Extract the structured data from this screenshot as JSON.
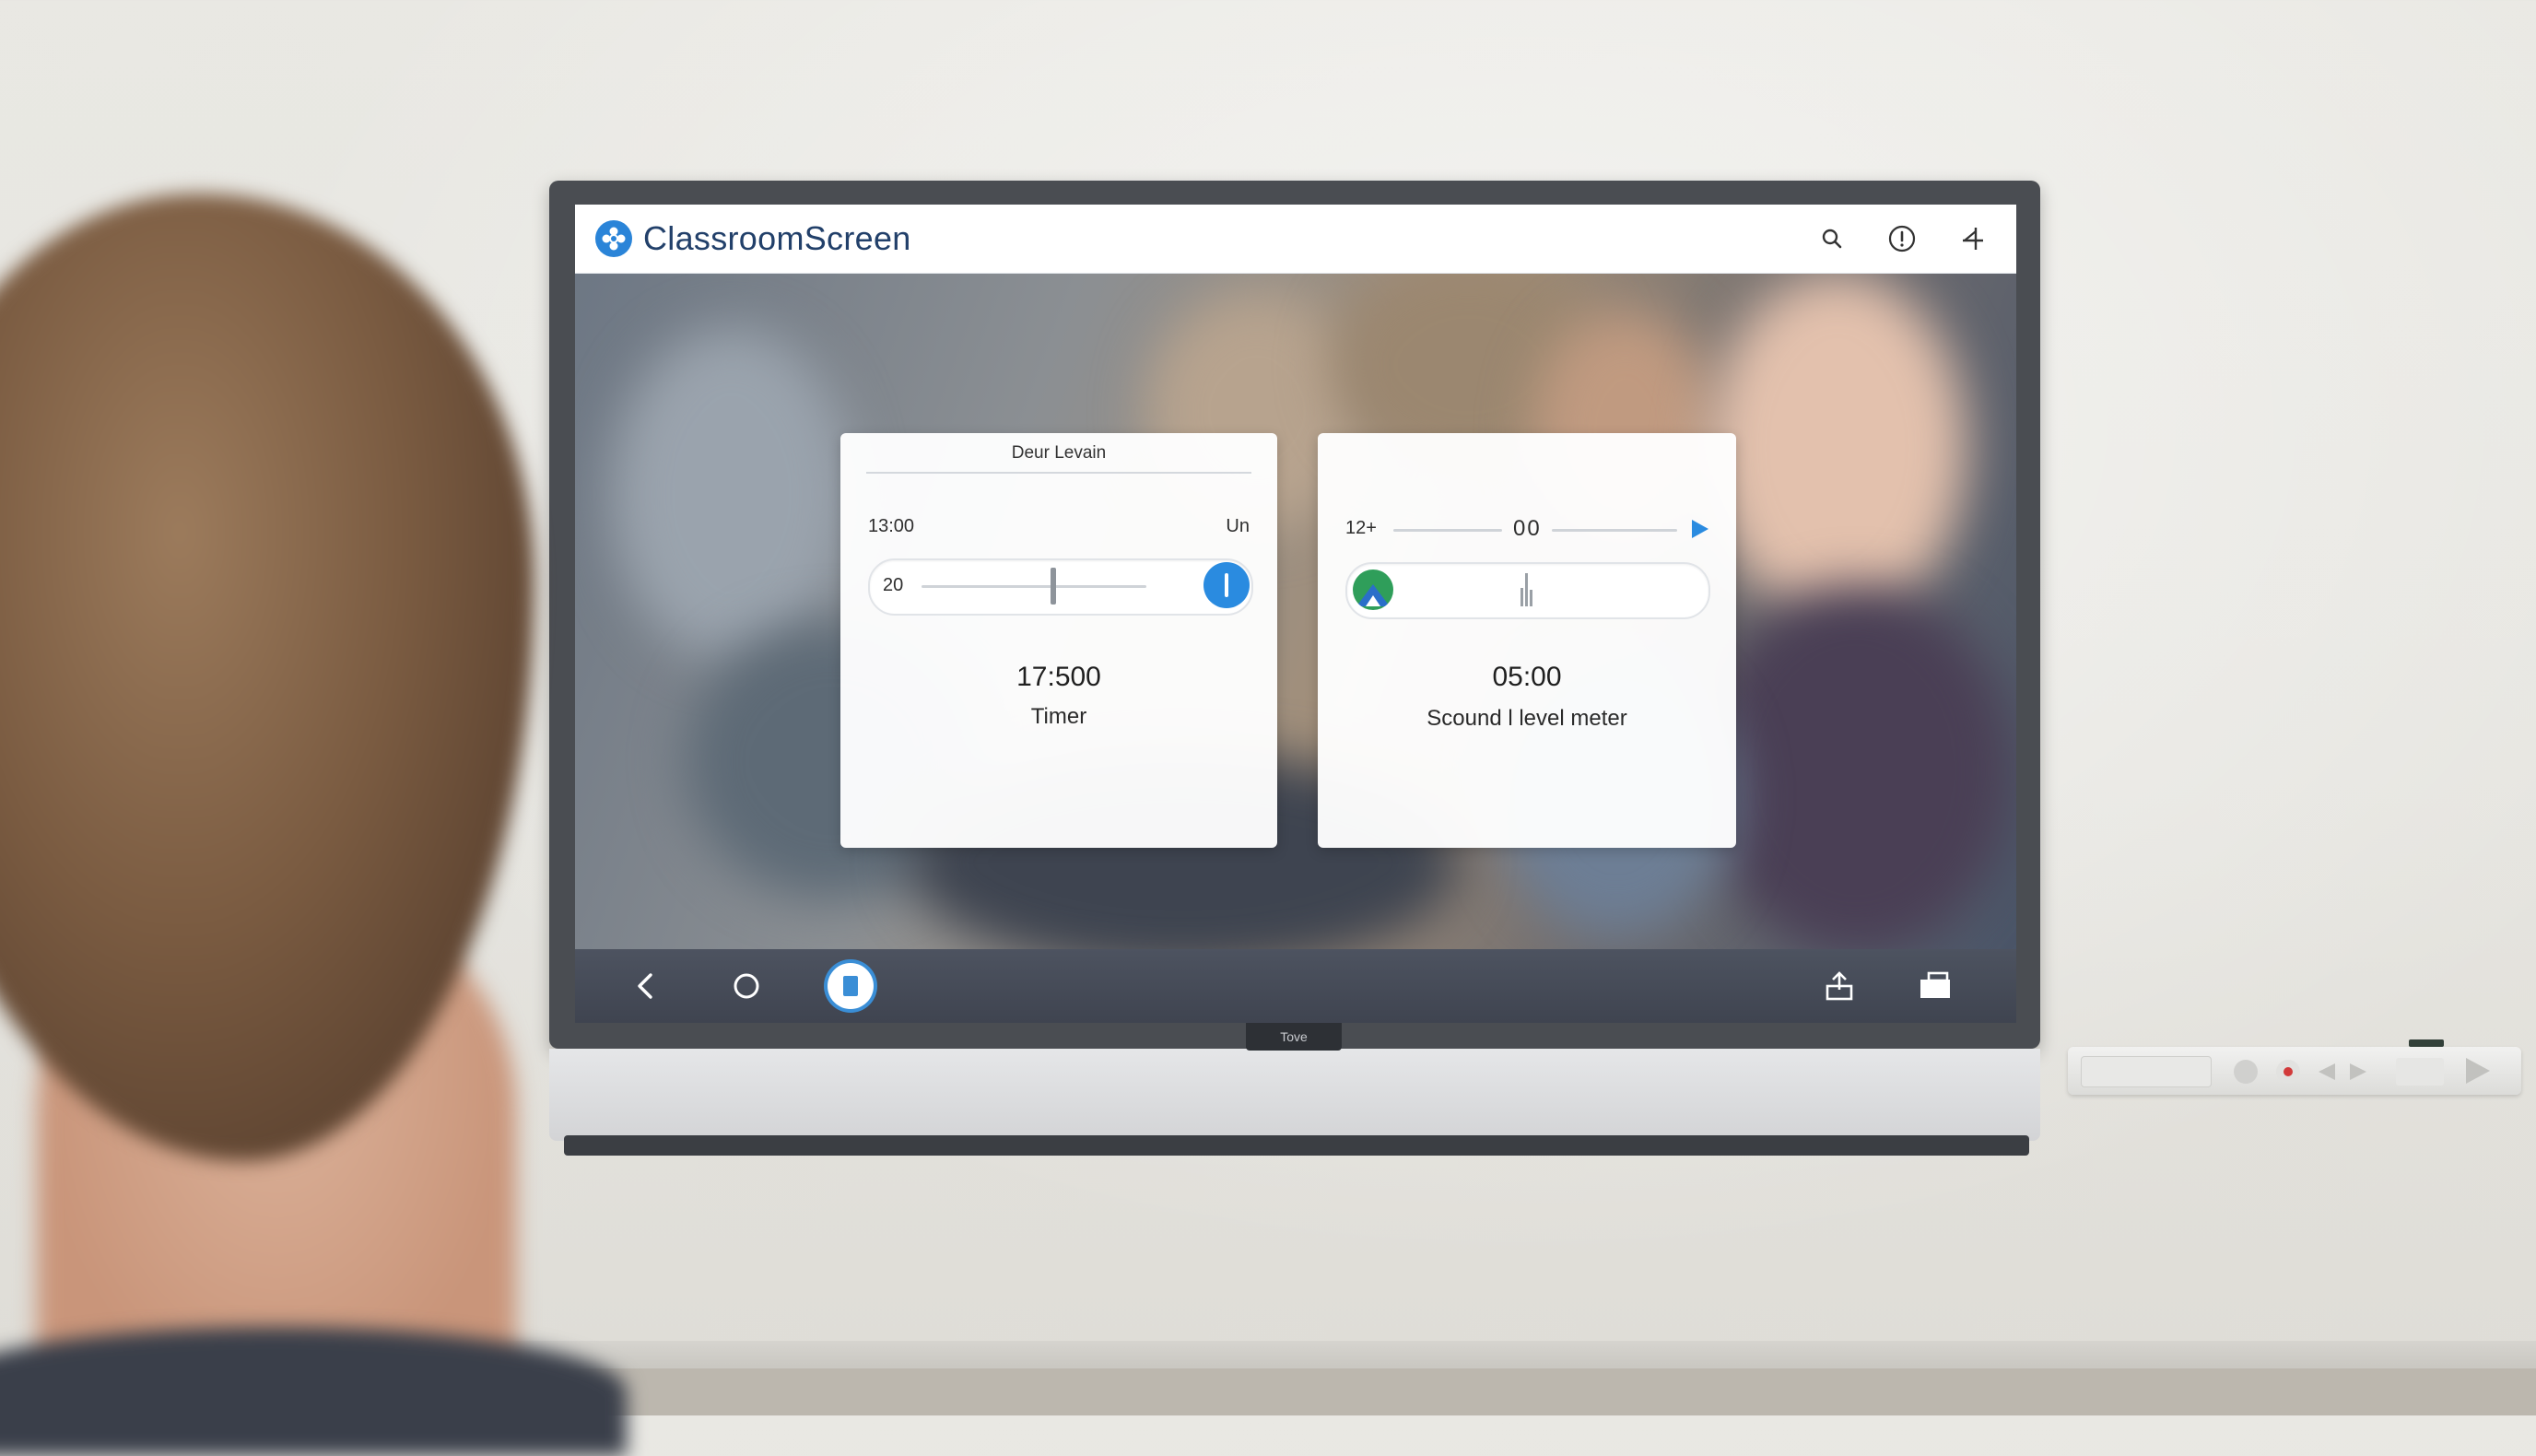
{
  "app": {
    "title": "ClassroomScreen",
    "logo_icon": "flower-icon",
    "accent_color": "#2a84d8",
    "actions": [
      {
        "icon": "search-icon"
      },
      {
        "icon": "info-icon"
      },
      {
        "icon": "pin-icon"
      }
    ]
  },
  "timer_card": {
    "header": "Deur Levain",
    "left_label": "13:00",
    "right_label": "Un",
    "slider_value_label": "20",
    "time": "17:500",
    "label": "Timer"
  },
  "sound_card": {
    "left_label": "12+",
    "middle_label": "00",
    "time": "05:00",
    "label": "Scound l level meter"
  },
  "navbar": {
    "items": [
      {
        "icon": "back-icon"
      },
      {
        "icon": "home-icon"
      },
      {
        "icon": "recent-apps-icon",
        "active": true
      },
      {
        "icon": "share-icon"
      },
      {
        "icon": "window-icon"
      }
    ]
  },
  "tv": {
    "brand": "Tove"
  }
}
